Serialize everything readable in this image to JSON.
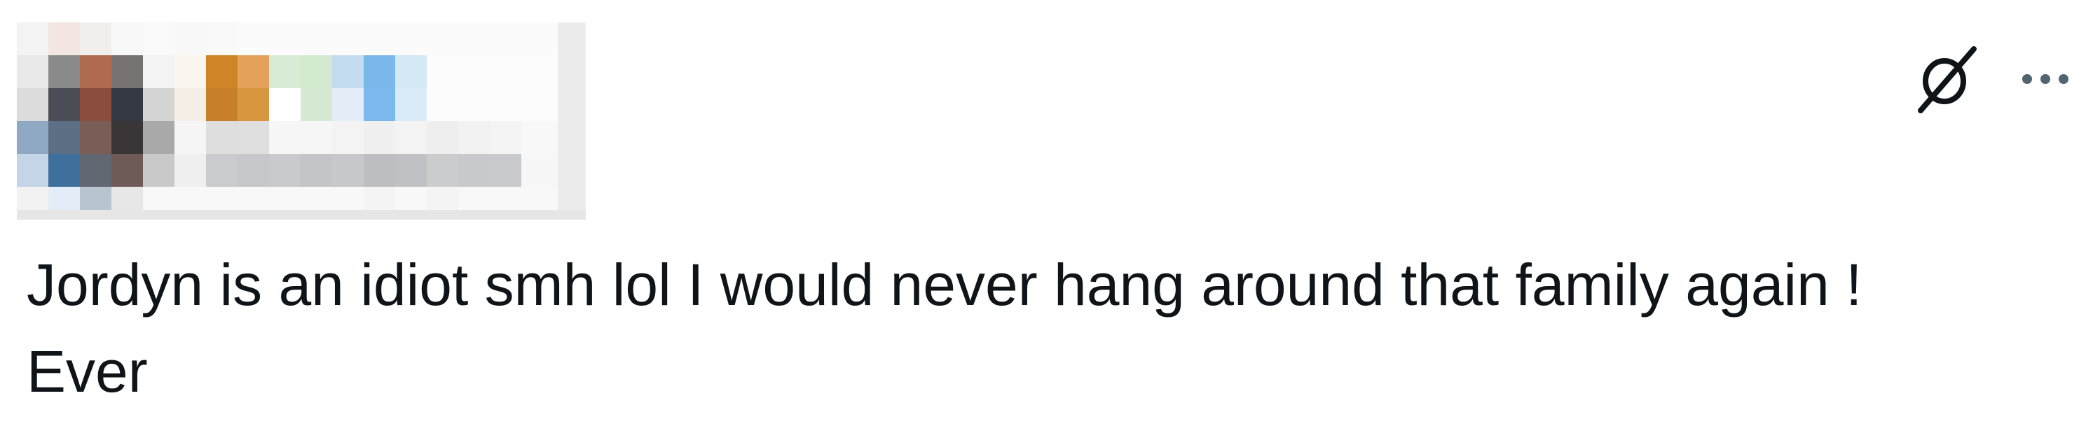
{
  "post": {
    "text_lines": [
      "Jordyn is an idiot smh lol I would never hang around that family again !",
      "Ever"
    ]
  },
  "header": {
    "author_redacted": true
  },
  "actions": {
    "grok_icon": "grok-icon",
    "more_icon": "more-options-icon"
  },
  "colors": {
    "text": "#0f1419",
    "icon": "#536471",
    "background": "#ffffff"
  }
}
